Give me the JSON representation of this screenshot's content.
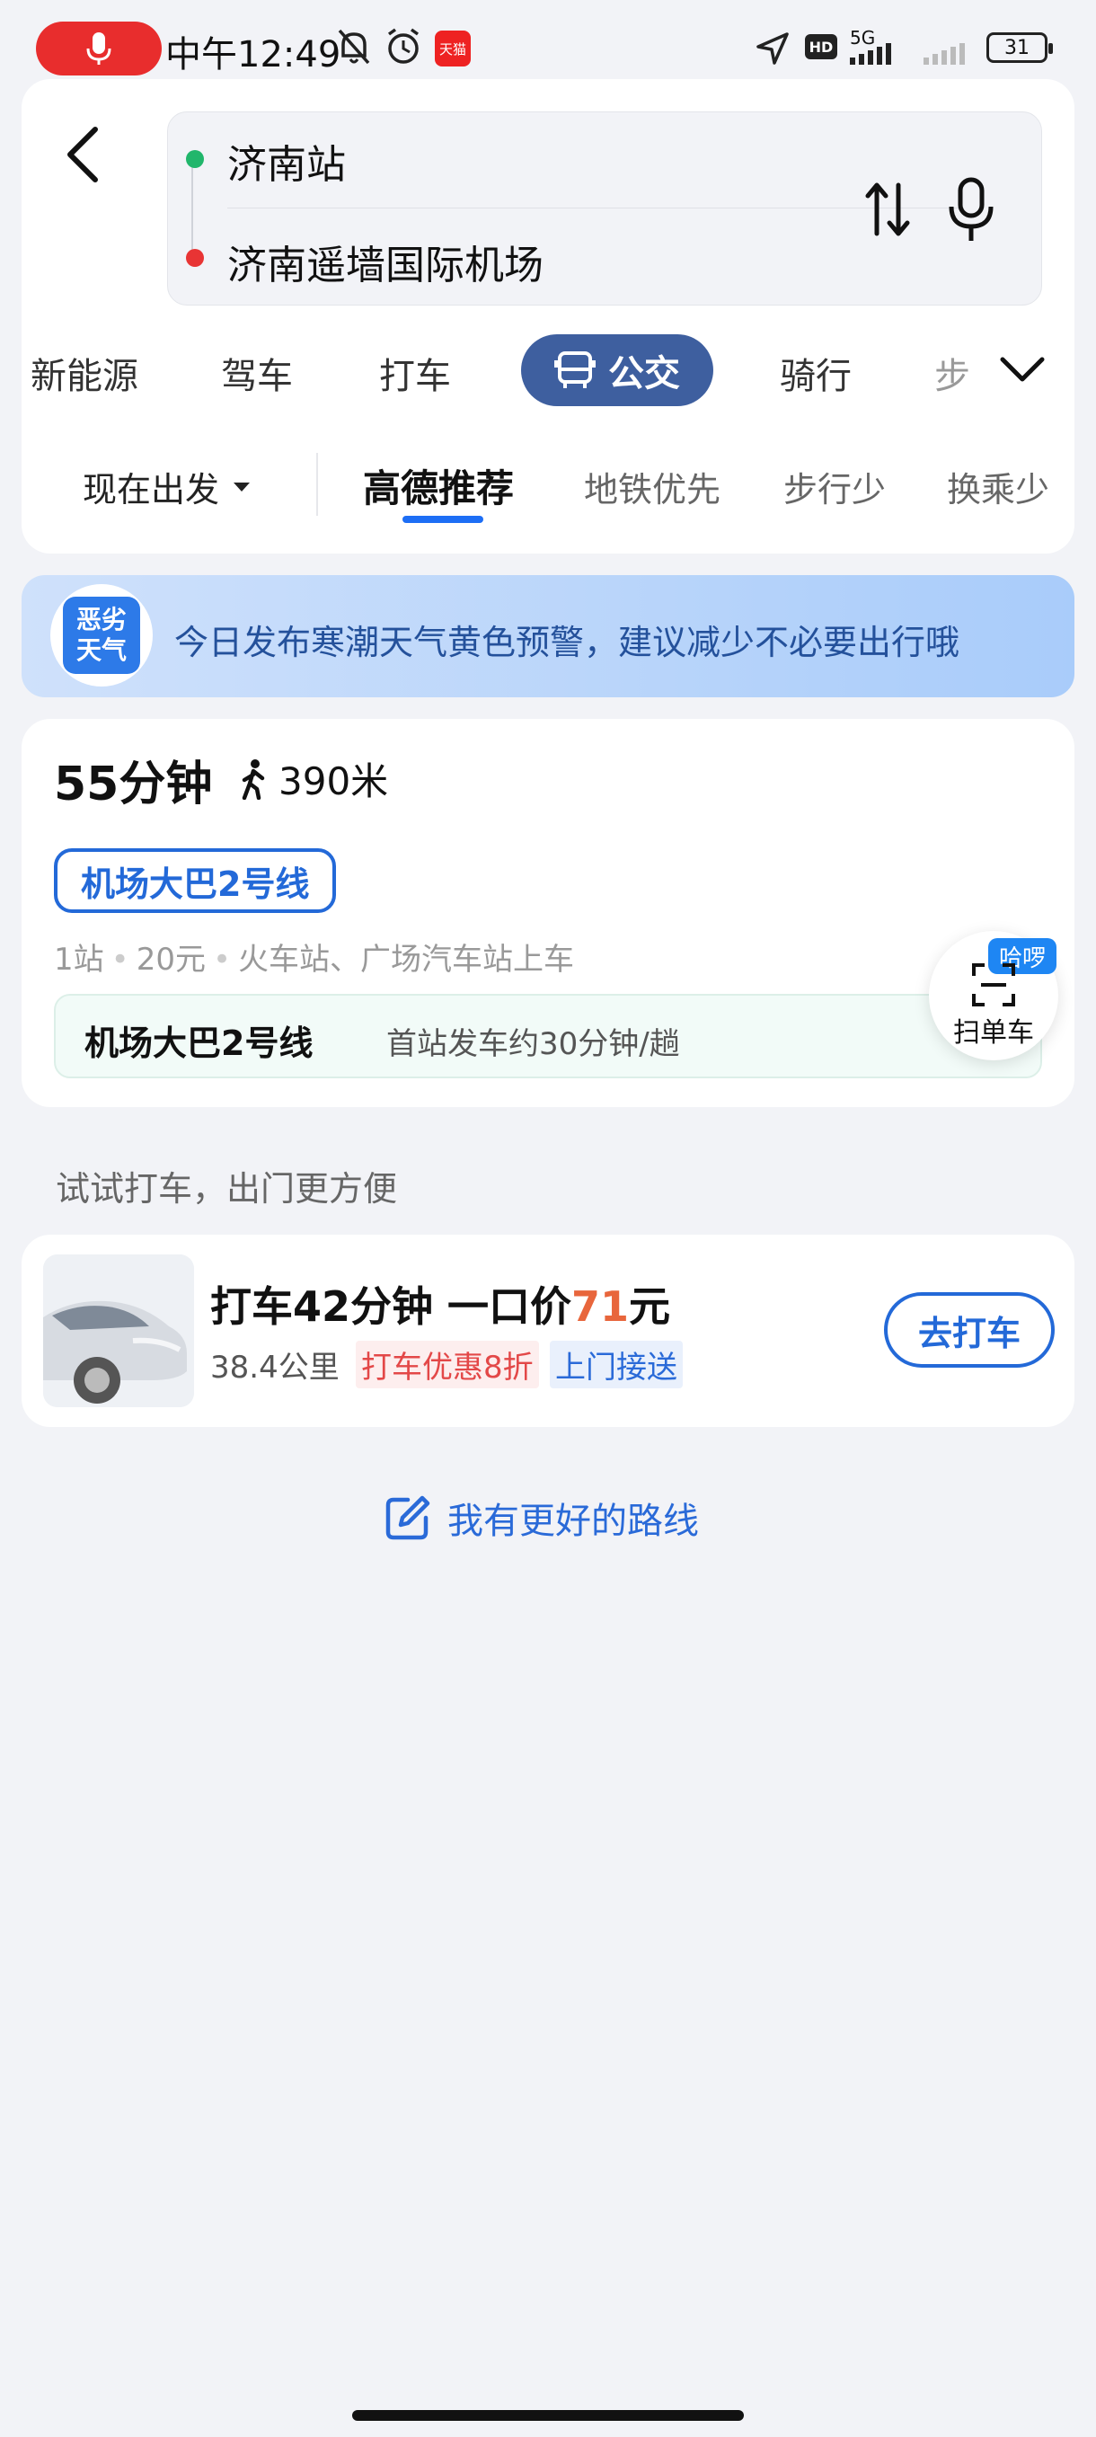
{
  "status_bar": {
    "time": "中午12:49",
    "network": "5G",
    "hd": "HD",
    "battery": "31",
    "tmall": "天猫"
  },
  "route": {
    "origin": "济南站",
    "destination": "济南遥墙国际机场"
  },
  "modes": [
    "新能源",
    "驾车",
    "打车",
    "公交",
    "骑行",
    "步"
  ],
  "active_mode": "公交",
  "depart": "现在出发",
  "subtabs": [
    "高德推荐",
    "地铁优先",
    "步行少",
    "换乘少"
  ],
  "weather": {
    "badge_line1": "恶劣",
    "badge_line2": "天气",
    "text": "今日发布寒潮天气黄色预警，建议减少不必要出行哦"
  },
  "result": {
    "duration": "55分钟",
    "walk": "390米",
    "line_tag": "机场大巴2号线",
    "stops": "1站",
    "price": "20元",
    "boarding": "火车站、广场汽车站上车",
    "freq_line": "机场大巴2号线",
    "freq_info": "首站发车约30分钟/趟"
  },
  "scan": {
    "badge": "哈啰",
    "label": "扫单车"
  },
  "taxi": {
    "section_title": "试试打车，出门更方便",
    "title_prefix": "打车42分钟 一口价",
    "price": "71",
    "title_suffix": "元",
    "distance": "38.4公里",
    "tag_discount": "打车优惠8折",
    "tag_pickup": "上门接送",
    "button": "去打车"
  },
  "better_route": "我有更好的路线",
  "colors": {
    "accent_blue": "#2369d8",
    "active_mode_bg": "#3e5f9f",
    "price_orange": "#e8663c",
    "record_red": "#e82d2d"
  }
}
